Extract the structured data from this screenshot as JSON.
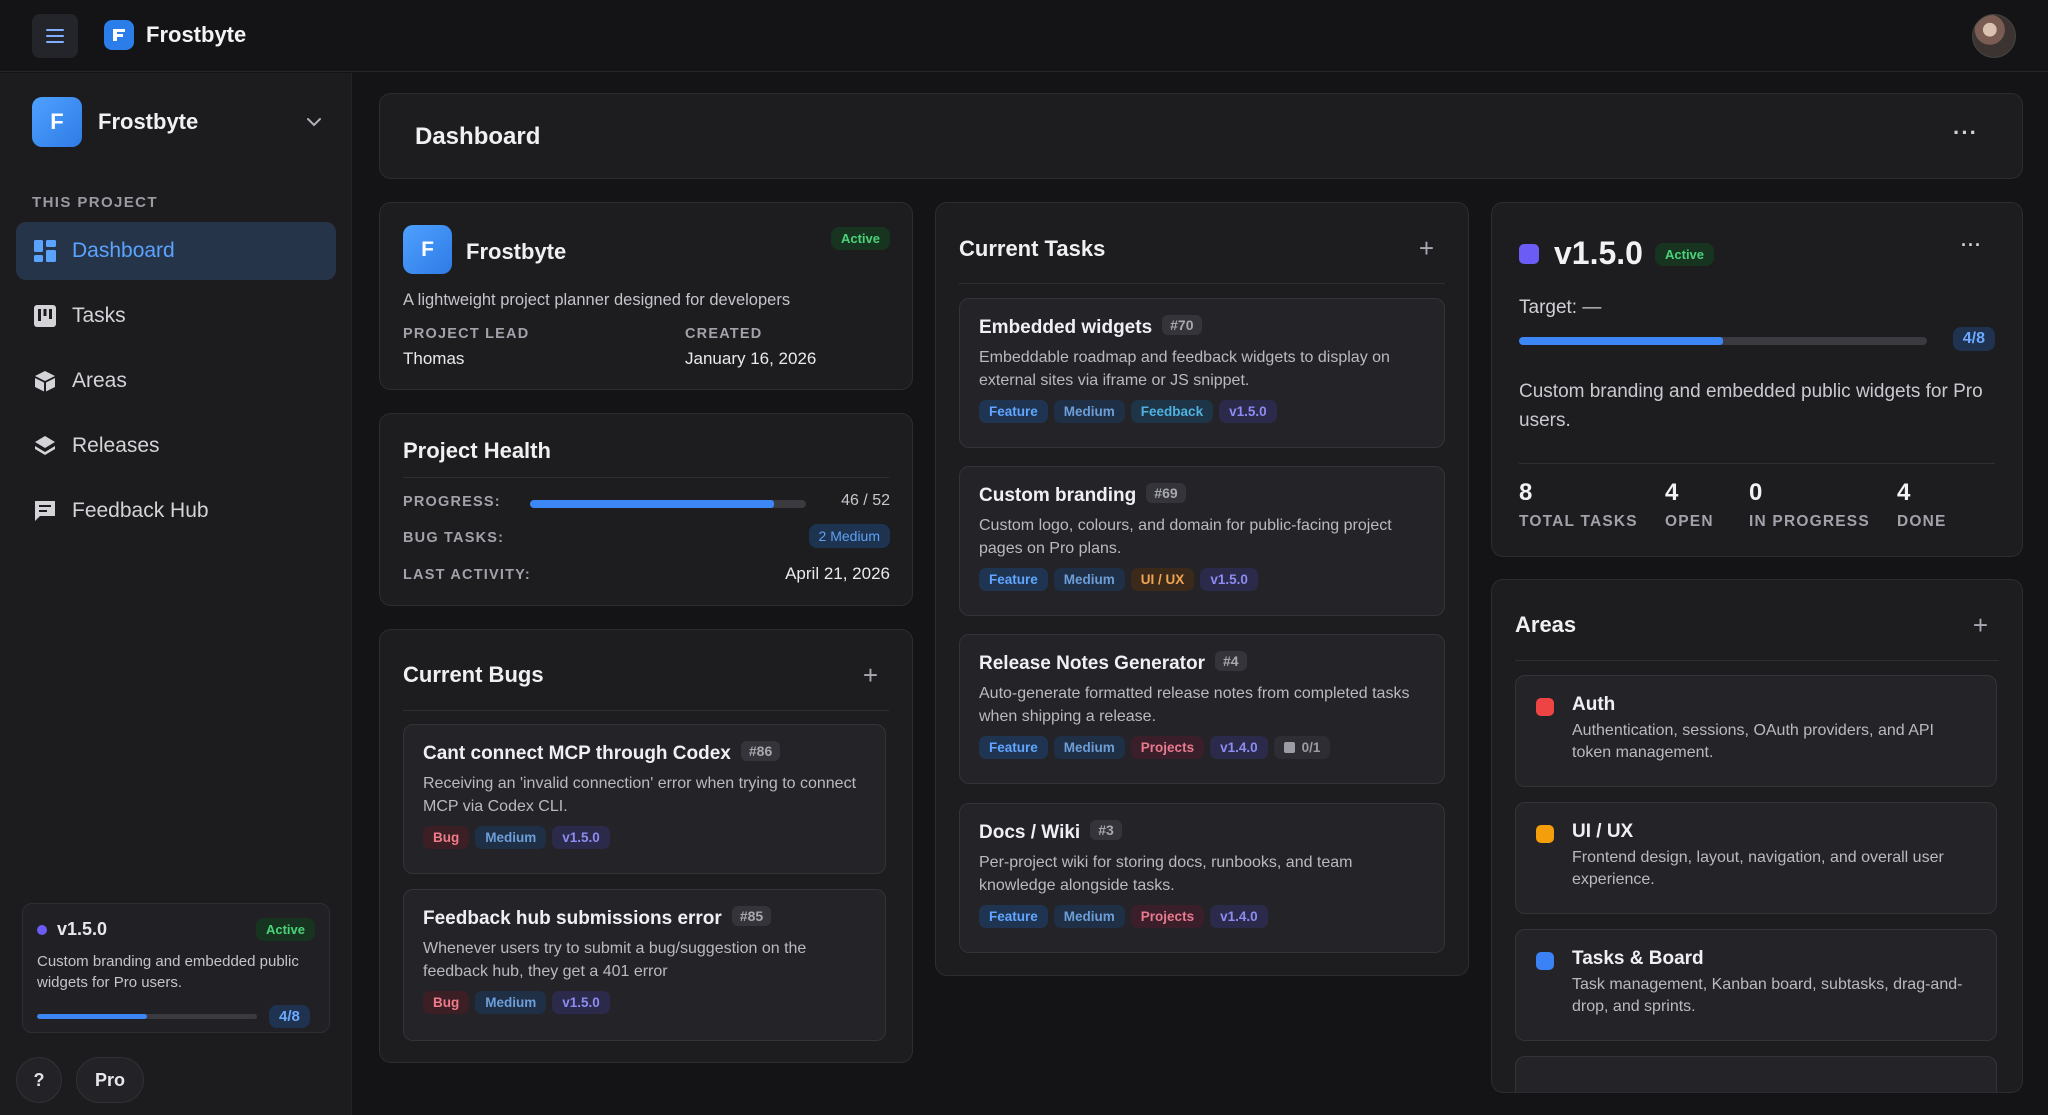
{
  "app": {
    "name": "Frostbyte",
    "avatar_letter": "F"
  },
  "sidebar": {
    "project_name": "Frostbyte",
    "project_letter": "F",
    "section_label": "THIS PROJECT",
    "items": [
      {
        "label": "Dashboard",
        "icon": "dashboard-icon",
        "active": true
      },
      {
        "label": "Tasks",
        "icon": "kanban-icon",
        "active": false
      },
      {
        "label": "Areas",
        "icon": "cube-icon",
        "active": false
      },
      {
        "label": "Releases",
        "icon": "layers-icon",
        "active": false
      },
      {
        "label": "Feedback Hub",
        "icon": "chat-icon",
        "active": false
      }
    ],
    "release": {
      "version": "v1.5.0",
      "status": "Active",
      "description": "Custom branding and embedded public widgets for Pro users.",
      "progress_fraction": 0.5,
      "count": "4/8"
    },
    "help_label": "?",
    "pro_label": "Pro"
  },
  "header": {
    "title": "Dashboard"
  },
  "project_card": {
    "name": "Frostbyte",
    "letter": "F",
    "status": "Active",
    "description": "A lightweight project planner designed for developers",
    "lead_label": "PROJECT LEAD",
    "lead": "Thomas",
    "created_label": "CREATED",
    "created": "January 16, 2026"
  },
  "health": {
    "title": "Project Health",
    "progress_label": "PROGRESS:",
    "progress_value": "46 / 52",
    "progress_fraction": 0.885,
    "bug_label": "BUG TASKS:",
    "bug_value": "2 Medium",
    "activity_label": "LAST ACTIVITY:",
    "activity_value": "April 21, 2026"
  },
  "bugs": {
    "title": "Current Bugs",
    "items": [
      {
        "title": "Cant connect MCP through Codex",
        "num": "#86",
        "description": "Receiving an 'invalid connection' error when trying to connect MCP via Codex CLI.",
        "tags": [
          "Bug",
          "Medium",
          "v1.5.0"
        ]
      },
      {
        "title": "Feedback hub submissions error",
        "num": "#85",
        "description": "Whenever users try to submit a bug/suggestion on the feedback hub, they get a 401 error",
        "tags": [
          "Bug",
          "Medium",
          "v1.5.0"
        ]
      }
    ]
  },
  "tasks": {
    "title": "Current Tasks",
    "items": [
      {
        "title": "Embedded widgets",
        "num": "#70",
        "description": "Embeddable roadmap and feedback widgets to display on external sites via iframe or JS snippet.",
        "tags": [
          "Feature",
          "Medium",
          "Feedback",
          "v1.5.0"
        ]
      },
      {
        "title": "Custom branding",
        "num": "#69",
        "description": "Custom logo, colours, and domain for public-facing project pages on Pro plans.",
        "tags": [
          "Feature",
          "Medium",
          "UI / UX",
          "v1.5.0"
        ]
      },
      {
        "title": "Release Notes Generator",
        "num": "#4",
        "description": "Auto-generate formatted release notes from completed tasks when shipping a release.",
        "tags": [
          "Feature",
          "Medium",
          "Projects",
          "v1.4.0"
        ],
        "subtasks": "0/1"
      },
      {
        "title": "Docs / Wiki",
        "num": "#3",
        "description": "Per-project wiki for storing docs, runbooks, and team knowledge alongside tasks.",
        "tags": [
          "Feature",
          "Medium",
          "Projects",
          "v1.4.0"
        ]
      }
    ]
  },
  "release_panel": {
    "version": "v1.5.0",
    "status": "Active",
    "target": "Target: —",
    "progress_fraction": 0.5,
    "count": "4/8",
    "description": "Custom branding and embedded public widgets for Pro users.",
    "stats": [
      {
        "value": "8",
        "label": "TOTAL TASKS"
      },
      {
        "value": "4",
        "label": "OPEN"
      },
      {
        "value": "0",
        "label": "IN PROGRESS"
      },
      {
        "value": "4",
        "label": "DONE"
      }
    ],
    "color": "#6b5cf6"
  },
  "areas": {
    "title": "Areas",
    "items": [
      {
        "title": "Auth",
        "description": "Authentication, sessions, OAuth providers, and API token management.",
        "color": "#ef4444"
      },
      {
        "title": "UI / UX",
        "description": "Frontend design, layout, navigation, and overall user experience.",
        "color": "#f59e0b"
      },
      {
        "title": "Tasks & Board",
        "description": "Task management, Kanban board, subtasks, drag-and-drop, and sprints.",
        "color": "#3b82f6"
      }
    ]
  }
}
